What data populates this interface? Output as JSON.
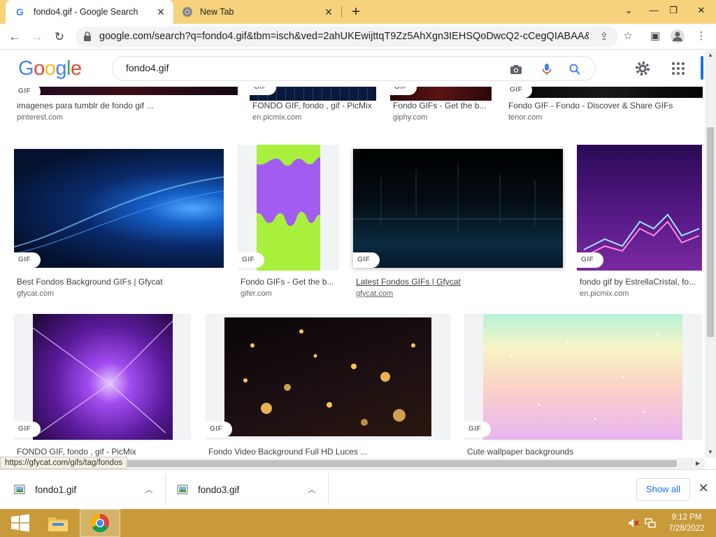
{
  "browser": {
    "tabs": [
      {
        "title": "fondo4.gif - Google Search",
        "active": true,
        "favicon": "google-icon"
      },
      {
        "title": "New Tab",
        "active": false,
        "favicon": "chrome-icon"
      }
    ],
    "url": "google.com/search?q=fondo4.gif&tbm=isch&ved=2ahUKEwijttqT9Zz5AhXgn3IEHSQoDwcQ2-cCegQIABAA&oq...",
    "status_url": "https://gfycat.com/gifs/tag/fondos"
  },
  "google": {
    "logo": "Google",
    "logo_colors": [
      "#4285f4",
      "#ea4335",
      "#fbbc05",
      "#4285f4",
      "#34a853",
      "#ea4335"
    ],
    "query": "fondo4.gif"
  },
  "results": {
    "badge": "GIF",
    "row0": [
      {
        "title": "imagenes para tumblr de fondo gif ...",
        "source": "pinterest.com"
      },
      {
        "title": "FONDO GIF, fondo , gif - PicMix",
        "source": "en.picmix.com"
      },
      {
        "title": "Fondo GIFs - Get the b...",
        "source": "giphy.com"
      },
      {
        "title": "Fondo GIF - Fondo - Discover & Share GIFs",
        "source": "tenor.com"
      }
    ],
    "row1": [
      {
        "title": "Best Fondos Background GIFs | Gfycat",
        "source": "gfycat.com"
      },
      {
        "title": "Fondo GIFs - Get the b...",
        "source": "gifer.com"
      },
      {
        "title": "Latest Fondos GIFs | Gfycat",
        "source": "gfycat.com"
      },
      {
        "title": "fondo gif by EstrellaCristal, fo...",
        "source": "en.picmix.com"
      }
    ],
    "row2": [
      {
        "title": "FONDO GIF, fondo , gif - PicMix"
      },
      {
        "title": "Fondo Video Background Full HD Luces ..."
      },
      {
        "title": "Cute wallpaper backgrounds"
      }
    ]
  },
  "downloads": {
    "items": [
      {
        "name": "fondo1.gif"
      },
      {
        "name": "fondo3.gif"
      }
    ],
    "show_all": "Show all"
  },
  "taskbar": {
    "time": "9:12 PM",
    "date": "7/28/2022"
  }
}
